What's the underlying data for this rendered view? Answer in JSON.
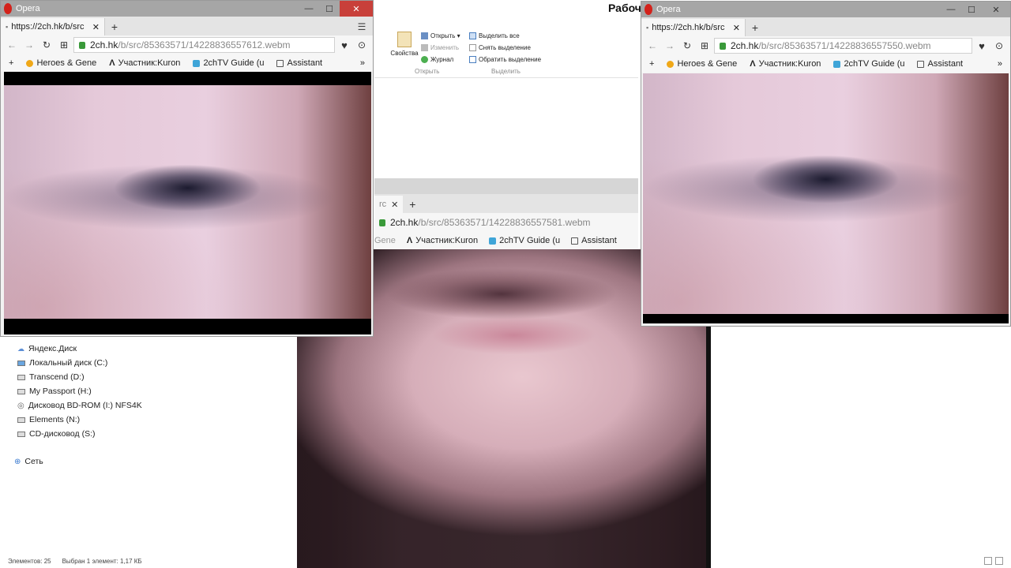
{
  "explorer": {
    "ribbon_title": "Рабоч",
    "ribbon": {
      "properties_label": "Свойства",
      "open_items": [
        "Открыть ▾",
        "Изменить",
        "Журнал"
      ],
      "open_group": "Открыть",
      "select_items": [
        "Выделить все",
        "Снять выделение",
        "Обратить выделение"
      ],
      "select_group": "Выделить"
    },
    "nav": [
      {
        "label": "Яндекс.Диск",
        "icon": "cloud-icon"
      },
      {
        "label": "Локальный диск (C:)",
        "icon": "windows-drive-icon"
      },
      {
        "label": "Transcend (D:)",
        "icon": "drive-icon"
      },
      {
        "label": "My Passport (H:)",
        "icon": "drive-icon"
      },
      {
        "label": "Дисковод BD-ROM (I:) NFS4K",
        "icon": "disc-icon"
      },
      {
        "label": "Elements (N:)",
        "icon": "drive-icon"
      },
      {
        "label": "CD-дисковод (S:)",
        "icon": "disc-icon"
      }
    ],
    "network_label": "Сеть",
    "status": {
      "items_count": "Элементов: 25",
      "selected": "Выбран 1 элемент: 1,17 КБ"
    }
  },
  "windows": {
    "left": {
      "app_title": "Opera",
      "tab_label": "https://2ch.hk/b/src",
      "url_host": "2ch.hk",
      "url_path": "/b/src/85363571/14228836557612.webm"
    },
    "right": {
      "app_title": "Opera",
      "tab_label": "https://2ch.hk/b/src",
      "url_host": "2ch.hk",
      "url_path": "/b/src/85363571/14228836557550.webm"
    },
    "middle": {
      "tab_label": "rc",
      "url_host": "2ch.hk",
      "url_path": "/b/src/85363571/14228836557581.webm"
    }
  },
  "bookmarks": {
    "heroes": "Heroes & Gene",
    "heroes_short": "Gene",
    "member": "Участник:Kuron",
    "tv_guide": "2chTV Guide (u",
    "assistant": "Assistant"
  },
  "colors": {
    "opera_red": "#d3221b",
    "titlebar_bg": "#a6a6a6",
    "close_btn": "#c8403a"
  }
}
